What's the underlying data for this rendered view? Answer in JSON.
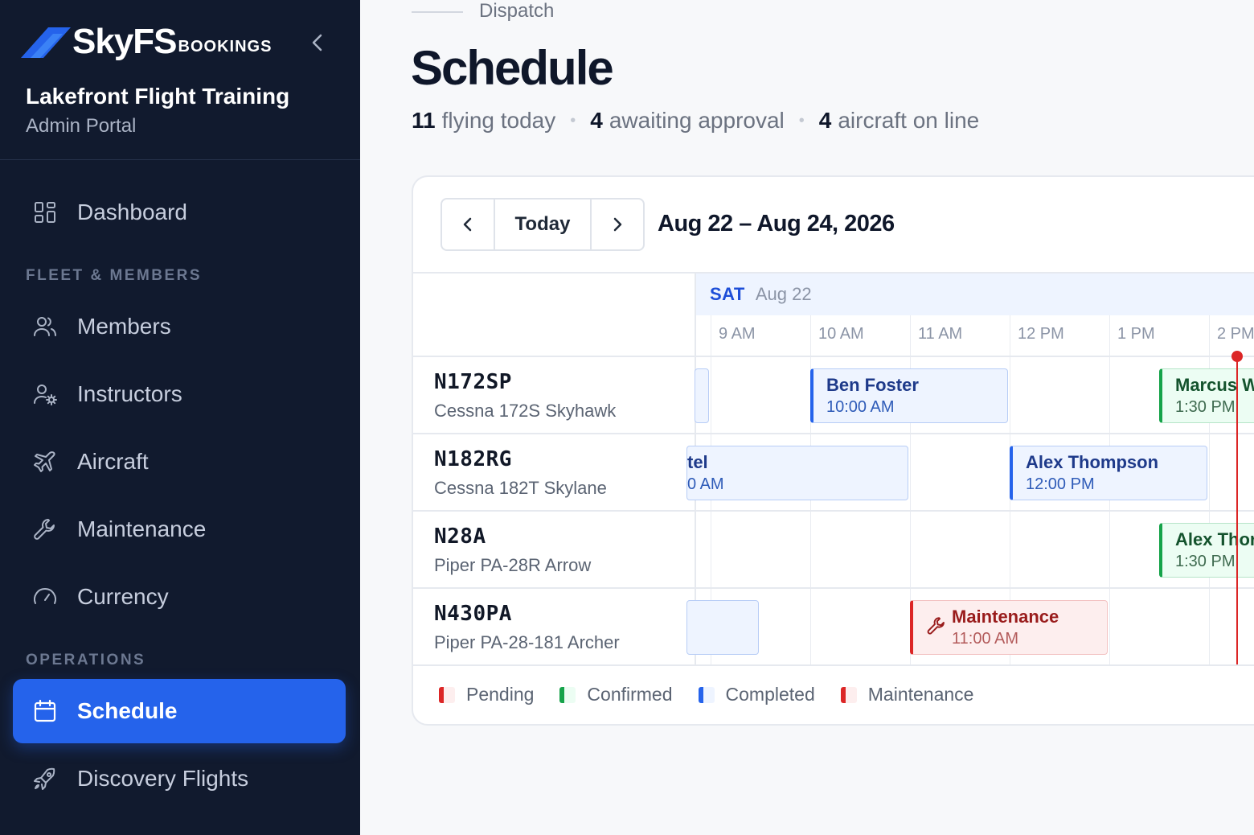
{
  "brand": {
    "word": "SkyFS",
    "sub": "BOOKINGS"
  },
  "org": {
    "name": "Lakefront Flight Training",
    "portal": "Admin Portal"
  },
  "nav": {
    "dashboard": "Dashboard",
    "section_fleet": "FLEET & MEMBERS",
    "members": "Members",
    "instructors": "Instructors",
    "aircraft": "Aircraft",
    "maintenance": "Maintenance",
    "currency": "Currency",
    "section_ops": "OPERATIONS",
    "schedule": "Schedule",
    "discovery": "Discovery Flights"
  },
  "header": {
    "breadcrumb": "Dispatch",
    "title": "Schedule",
    "stats": [
      {
        "value": "11",
        "label": "flying today"
      },
      {
        "value": "4",
        "label": "awaiting approval"
      },
      {
        "value": "4",
        "label": "aircraft on line"
      }
    ]
  },
  "calendar": {
    "today_label": "Today",
    "range": "Aug 22 – Aug 24, 2026",
    "day_name": "SAT",
    "day_date": "Aug 22",
    "hours": [
      "9 AM",
      "10 AM",
      "11 AM",
      "12 PM",
      "1 PM",
      "2 PM"
    ],
    "aircraft": [
      {
        "tail": "N172SP",
        "model": "Cessna 172S Skyhawk"
      },
      {
        "tail": "N182RG",
        "model": "Cessna 182T Skylane"
      },
      {
        "tail": "N28A",
        "model": "Piper PA-28R Arrow"
      },
      {
        "tail": "N430PA",
        "model": "Piper PA-28-181 Archer"
      }
    ],
    "events": [
      {
        "who": "",
        "time": "",
        "status": "completed"
      },
      {
        "who": "Ben Foster",
        "time": "10:00 AM",
        "status": "completed"
      },
      {
        "who": "Marcus W",
        "time": "1:30 PM",
        "status": "confirmed"
      },
      {
        "who": "tel",
        "time": "0 AM",
        "status": "completed"
      },
      {
        "who": "Alex Thompson",
        "time": "12:00 PM",
        "status": "completed"
      },
      {
        "who": "Alex Thor",
        "time": "1:30 PM",
        "status": "confirmed"
      },
      {
        "who": "",
        "time": "",
        "status": "completed"
      },
      {
        "who": "Maintenance",
        "time": "11:00 AM",
        "status": "maintenance"
      }
    ],
    "legend": [
      {
        "label": "Pending",
        "color": "#dc2626"
      },
      {
        "label": "Confirmed",
        "color": "#16a34a"
      },
      {
        "label": "Completed",
        "color": "#2563eb"
      },
      {
        "label": "Maintenance",
        "color": "#dc2626"
      }
    ]
  },
  "colors": {
    "sidebar_bg": "#111a2e",
    "accent": "#2563eb",
    "confirmed": "#16a34a",
    "maintenance": "#dc2626",
    "now_line": "#dc2626"
  }
}
